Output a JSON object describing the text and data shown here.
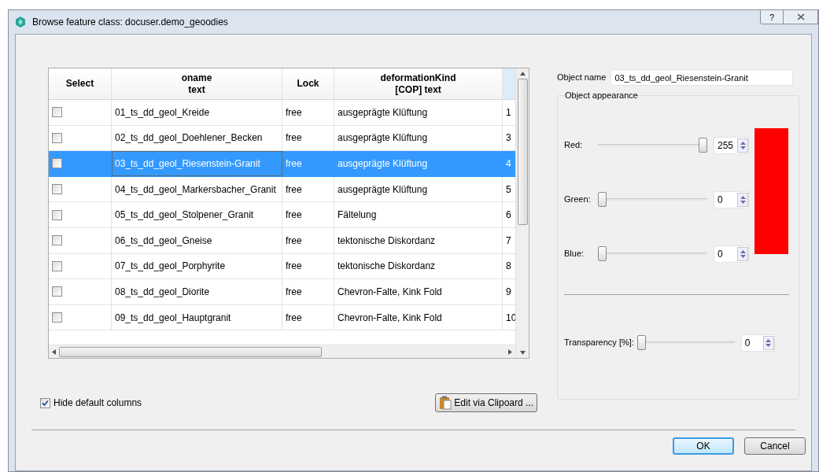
{
  "window": {
    "title": "Browse feature class: docuser.demo_geoodies",
    "help_button": "?"
  },
  "table": {
    "columns": [
      {
        "line1": "Select"
      },
      {
        "line1": "oname",
        "line2": "text"
      },
      {
        "line1": "Lock"
      },
      {
        "line1": "deformationKind",
        "line2": "[COP] text"
      },
      {}
    ],
    "rows": [
      {
        "checked": false,
        "selected": false,
        "oname": "01_ts_dd_geol_Kreide",
        "lock": "free",
        "kind": "ausgeprägte Klüftung",
        "column_5": "1"
      },
      {
        "checked": false,
        "selected": false,
        "oname": "02_ts_dd_geol_Doehlener_Becken",
        "lock": "free",
        "kind": "ausgeprägte Klüftung",
        "column_5": "3"
      },
      {
        "checked": false,
        "selected": true,
        "oname": "03_ts_dd_geol_Riesenstein-Granit",
        "lock": "free",
        "kind": "ausgeprägte Klüftung",
        "column_5": "4"
      },
      {
        "checked": false,
        "selected": false,
        "oname": "04_ts_dd_geol_Markersbacher_Granit",
        "lock": "free",
        "kind": "ausgeprägte Klüftung",
        "column_5": "5"
      },
      {
        "checked": false,
        "selected": false,
        "oname": "05_ts_dd_geol_Stolpener_Granit",
        "lock": "free",
        "kind": "Fältelung",
        "column_5": "6"
      },
      {
        "checked": false,
        "selected": false,
        "oname": "06_ts_dd_geol_Gneise",
        "lock": "free",
        "kind": "tektonische Diskordanz",
        "column_5": "7"
      },
      {
        "checked": false,
        "selected": false,
        "oname": "07_ts_dd_geol_Porphyrite",
        "lock": "free",
        "kind": "tektonische Diskordanz",
        "column_5": "8"
      },
      {
        "checked": false,
        "selected": false,
        "oname": "08_ts_dd_geol_Diorite",
        "lock": "free",
        "kind": "Chevron-Falte, Kink Fold",
        "column_5": "9"
      },
      {
        "checked": false,
        "selected": false,
        "oname": "09_ts_dd_geol_Hauptgranit",
        "lock": "free",
        "kind": "Chevron-Falte, Kink Fold",
        "column_5": "10"
      }
    ]
  },
  "hide_default_columns": {
    "label": "Hide default columns",
    "checked": true
  },
  "edit_button": "Edit via Clipoard ...",
  "object_name": {
    "label": "Object name",
    "value": "03_ts_dd_geol_Riesenstein-Granit"
  },
  "appearance": {
    "title": "Object appearance",
    "channels": [
      {
        "label": "Red:",
        "level": 1,
        "value": "255"
      },
      {
        "label": "Green:",
        "level": 0,
        "value": "0"
      },
      {
        "label": "Blue:",
        "level": 0,
        "value": "0"
      }
    ],
    "transparency": {
      "label": "Transparency [%]:",
      "level": 0,
      "value": "0"
    }
  },
  "buttons": [
    {
      "label": "OK",
      "default": true
    },
    {
      "label": "Cancel",
      "default": false
    }
  ]
}
